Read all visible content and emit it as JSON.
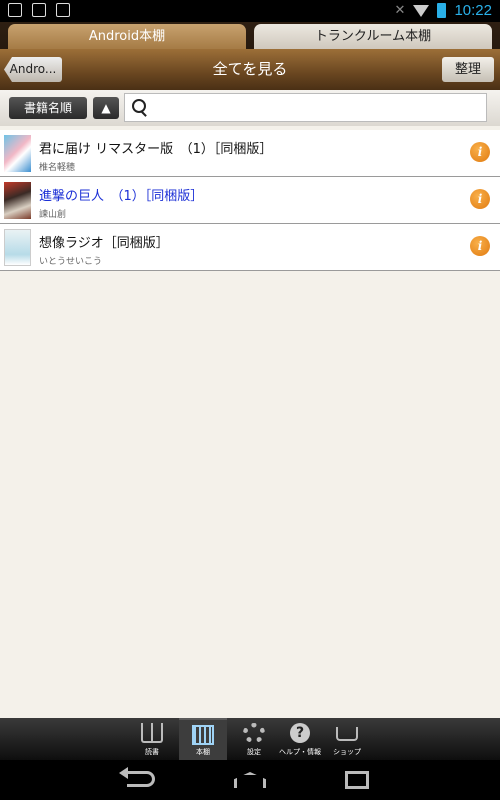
{
  "status_bar": {
    "time": "10:22"
  },
  "tabs": [
    {
      "label": "Android本棚",
      "active": true
    },
    {
      "label": "トランクルーム本棚",
      "active": false
    }
  ],
  "titlebar": {
    "back_label": "Andro...",
    "title": "全てを見る",
    "organize_label": "整理"
  },
  "search": {
    "sort_label": "書籍名順",
    "order_label": "▲",
    "value": "",
    "placeholder": ""
  },
  "books": [
    {
      "title": "君に届け リマスター版　（1）［同梱版］",
      "author": "椎名軽穂",
      "highlight": false
    },
    {
      "title": "進撃の巨人　（1）［同梱版］",
      "author": "諫山創",
      "highlight": true
    },
    {
      "title": "想像ラジオ［同梱版］",
      "author": "いとうせいこう",
      "highlight": false
    }
  ],
  "bottom_tabs": [
    {
      "label": "読書",
      "icon": "book-open-icon"
    },
    {
      "label": "本棚",
      "icon": "bookshelf-icon",
      "active": true
    },
    {
      "label": "設定",
      "icon": "gear-icon"
    },
    {
      "label": "ヘルプ・情報",
      "icon": "help-icon"
    },
    {
      "label": "ショップ",
      "icon": "cart-icon"
    }
  ],
  "colors": {
    "accent_blue": "#2ab0e8",
    "link_blue": "#1b2fd6",
    "header_brown": "#6a4620",
    "info_orange": "#e07a10"
  }
}
